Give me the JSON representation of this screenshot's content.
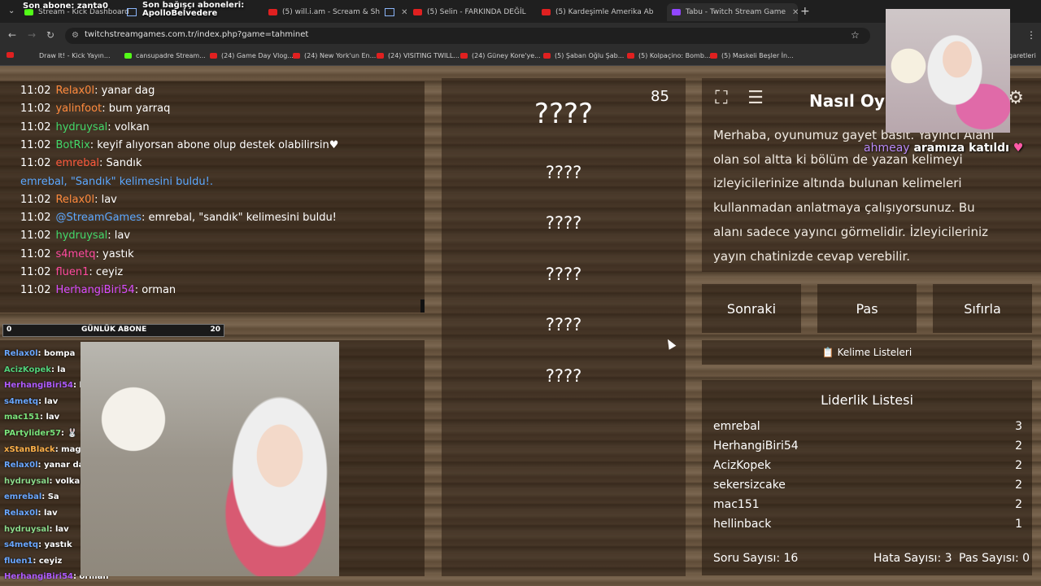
{
  "browser": {
    "tabs": [
      {
        "label": "Stream - Kick Dashboard",
        "icon": "kick-icon"
      },
      {
        "label": "",
        "icon": "window-icon"
      },
      {
        "label": "(5) will.i.am - Scream & Sh",
        "icon": "youtube-icon"
      },
      {
        "label": "(5) Selin - FARKINDA DEĞİL",
        "icon": "youtube-icon"
      },
      {
        "label": "(5) Kardeşimle Amerika Ab",
        "icon": "youtube-icon"
      },
      {
        "label": "Tabu - Twitch Stream Game",
        "icon": "twitch-icon"
      }
    ],
    "url": "twitchstreamgames.com.tr/index.php?game=tahminet",
    "bookmarks": [
      "Draw It! - Kick Yayın...",
      "cansupadre Stream...",
      "(24) Game Day Vlog...",
      "(24) New York'un En...",
      "(24) VISITING TWILL...",
      "(24) Güney Kore'ye...",
      "(5) Şaban Oğlu Şab...",
      "(5) Kolpaçino: Bomb...",
      "(5) Maskeli Beşler İn...",
      "garetleri"
    ]
  },
  "overlay": {
    "alert1": "Son abone: zanta0",
    "alert2_line1": "Son bağışçı aboneleri:",
    "alert2_line2": "ApolloBelvedere",
    "join_name": "ahmeay",
    "join_text": "aramıza katıldı",
    "sub_goal": {
      "current": "0",
      "label": "GÜNLÜK ABONE",
      "target": "20"
    },
    "chat": [
      {
        "user": "Relax0l",
        "msg": ": bompa",
        "color": "#6aa7ff"
      },
      {
        "user": "AcizKopek",
        "msg": ": la",
        "color": "#52d17a"
      },
      {
        "user": "HerhangiBiri54",
        "msg": ": kr",
        "color": "#b05cff"
      },
      {
        "user": "s4metq",
        "msg": ": lav",
        "color": "#6aa7ff"
      },
      {
        "user": "mac151",
        "msg": ": lav",
        "color": "#7be37b"
      },
      {
        "user": "PArtylider57",
        "msg": ": 🐰",
        "color": "#7be37b"
      },
      {
        "user": "xStanBlack",
        "msg": ": magm",
        "color": "#ffb24a"
      },
      {
        "user": "Relax0l",
        "msg": ": yanar dag",
        "color": "#6aa7ff"
      },
      {
        "user": "hydruysal",
        "msg": ": volkan",
        "color": "#8ad98a"
      },
      {
        "user": "emrebal",
        "msg": ": Sa",
        "color": "#6aa7ff"
      },
      {
        "user": "Relax0l",
        "msg": ": lav",
        "color": "#6aa7ff"
      },
      {
        "user": "hydruysal",
        "msg": ": lav",
        "color": "#8ad98a"
      },
      {
        "user": "s4metq",
        "msg": ": yastık",
        "color": "#6aa7ff"
      },
      {
        "user": "fluen1",
        "msg": ": ceyiz",
        "color": "#6aa7ff"
      },
      {
        "user": "HerhangiBiri54",
        "msg": ": orman",
        "color": "#b05cff"
      }
    ]
  },
  "game_chat": [
    {
      "time": "11:02",
      "user": "Relax0l",
      "msg": ": yanar dag",
      "color": "#ff8a3d"
    },
    {
      "time": "11:02",
      "user": "yalinfoot",
      "msg": ": bum yarraq",
      "color": "#ff8a3d"
    },
    {
      "time": "11:02",
      "user": "hydruysal",
      "msg": ": volkan",
      "color": "#43d86a"
    },
    {
      "time": "11:02",
      "user": "BotRix",
      "msg": ": keyif alıyorsan abone olup destek olabilirsin♥",
      "color": "#43d86a"
    },
    {
      "time": "11:02",
      "user": "emrebal",
      "msg": ": Sandık",
      "color": "#ff5a3d"
    },
    {
      "system": "emrebal, \"Sandık\" kelimesini buldu!."
    },
    {
      "time": "11:02",
      "user": "Relax0l",
      "msg": ": lav",
      "color": "#ff8a3d"
    },
    {
      "time": "11:02",
      "user": "@StreamGames",
      "msg": ": emrebal, \"sandık\" kelimesini buldu!",
      "color": "#5ca8ff"
    },
    {
      "time": "11:02",
      "user": "hydruysal",
      "msg": ": lav",
      "color": "#43d86a"
    },
    {
      "time": "11:02",
      "user": "s4metq",
      "msg": ": yastık",
      "color": "#ff4aa0"
    },
    {
      "time": "11:02",
      "user": "fluen1",
      "msg": ": ceyiz",
      "color": "#ff4aa0"
    },
    {
      "time": "11:02",
      "user": "HerhangiBiri54",
      "msg": ": orman",
      "color": "#d94cff"
    }
  ],
  "game": {
    "timer": "85",
    "hidden_words": [
      "????",
      "????",
      "????",
      "????",
      "????",
      "????"
    ],
    "how_title": "Nasıl Oyn",
    "how_text": "Merhaba, oyunumuz gayet basit. Yayıncı Alanı olan sol altta ki bölüm de yazan kelimeyi izleyicilerinize altında bulunan kelimeleri kullanmadan anlatmaya çalışıyorsunuz. Bu alanı sadece yayıncı görmelidir. İzleyicileriniz yayın chatinizde cevap verebilir.",
    "buttons": {
      "next": "Sonraki",
      "pass": "Pas",
      "reset": "Sıfırla"
    },
    "word_lists": "📋 Kelime Listeleri",
    "leaderboard_title": "Liderlik Listesi",
    "leaderboard": [
      {
        "name": "emrebal",
        "score": "3"
      },
      {
        "name": "HerhangiBiri54",
        "score": "2"
      },
      {
        "name": "AcizKopek",
        "score": "2"
      },
      {
        "name": "sekersizcake",
        "score": "2"
      },
      {
        "name": "mac151",
        "score": "2"
      },
      {
        "name": "hellinback",
        "score": "1"
      }
    ],
    "stats": {
      "questions": "Soru Sayısı: 16",
      "errors": "Hata Sayısı: 3",
      "passes": "Pas Sayısı: 0"
    }
  }
}
